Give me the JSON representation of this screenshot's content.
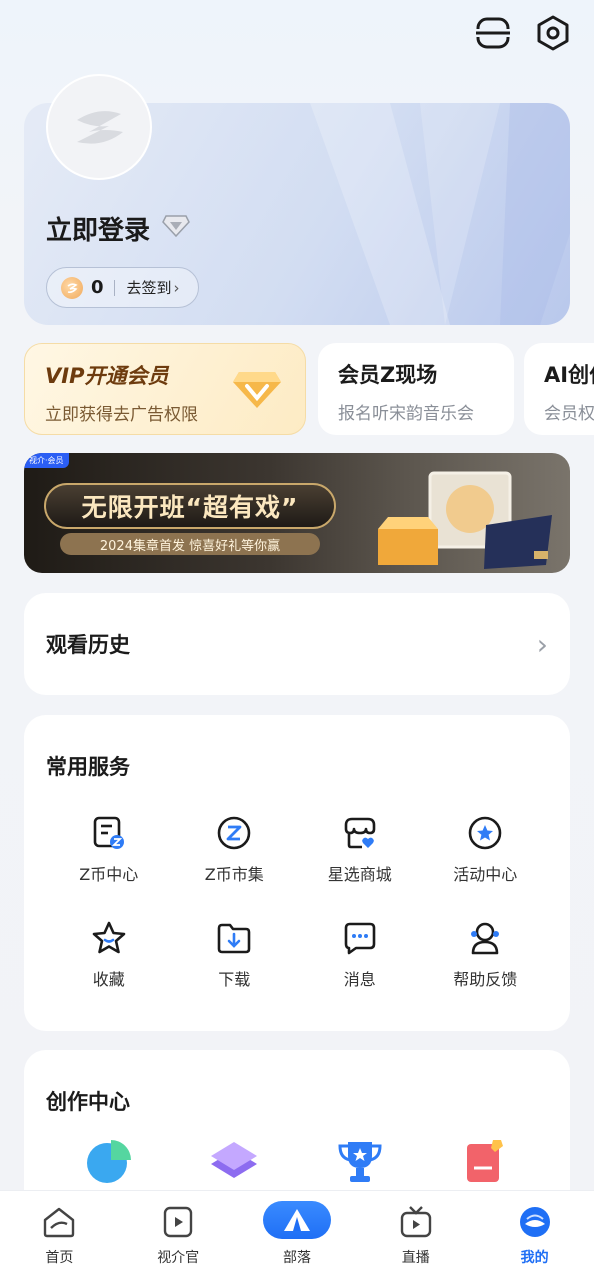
{
  "colors": {
    "accent": "#1f6ff5",
    "vip_text": "#6d3b0e",
    "page_bg": "#f2f3f7"
  },
  "topbar": {
    "icons": [
      "scan-icon",
      "settings-icon"
    ]
  },
  "profile": {
    "title": "立即登录",
    "coins": "0",
    "checkin_label": "去签到",
    "checkin_arrow": "›"
  },
  "promos": [
    {
      "title": "VIP开通会员",
      "subtitle": "立即获得去广告权限"
    },
    {
      "title": "会员Z现场",
      "subtitle": "报名听宋韵音乐会"
    },
    {
      "title": "AI创作",
      "subtitle": "会员权益"
    }
  ],
  "banner": {
    "tag": "视介·会员",
    "headline": "无限开班“超有戏”",
    "subline": "2024集章首发 惊喜好礼等你赢"
  },
  "history": {
    "label": "观看历史",
    "arrow": "›"
  },
  "services": {
    "heading": "常用服务",
    "items": [
      {
        "label": "Z币中心",
        "icon": "z-coin-center-icon"
      },
      {
        "label": "Z币市集",
        "icon": "z-coin-market-icon"
      },
      {
        "label": "星选商城",
        "icon": "store-icon"
      },
      {
        "label": "活动中心",
        "icon": "activity-icon"
      },
      {
        "label": "收藏",
        "icon": "favorite-star-icon"
      },
      {
        "label": "下载",
        "icon": "download-folder-icon"
      },
      {
        "label": "消息",
        "icon": "message-icon"
      },
      {
        "label": "帮助反馈",
        "icon": "help-feedback-icon"
      }
    ]
  },
  "create": {
    "heading": "创作中心"
  },
  "nav": {
    "items": [
      {
        "label": "首页"
      },
      {
        "label": "视介官"
      },
      {
        "label": "部落"
      },
      {
        "label": "直播"
      },
      {
        "label": "我的"
      }
    ]
  }
}
